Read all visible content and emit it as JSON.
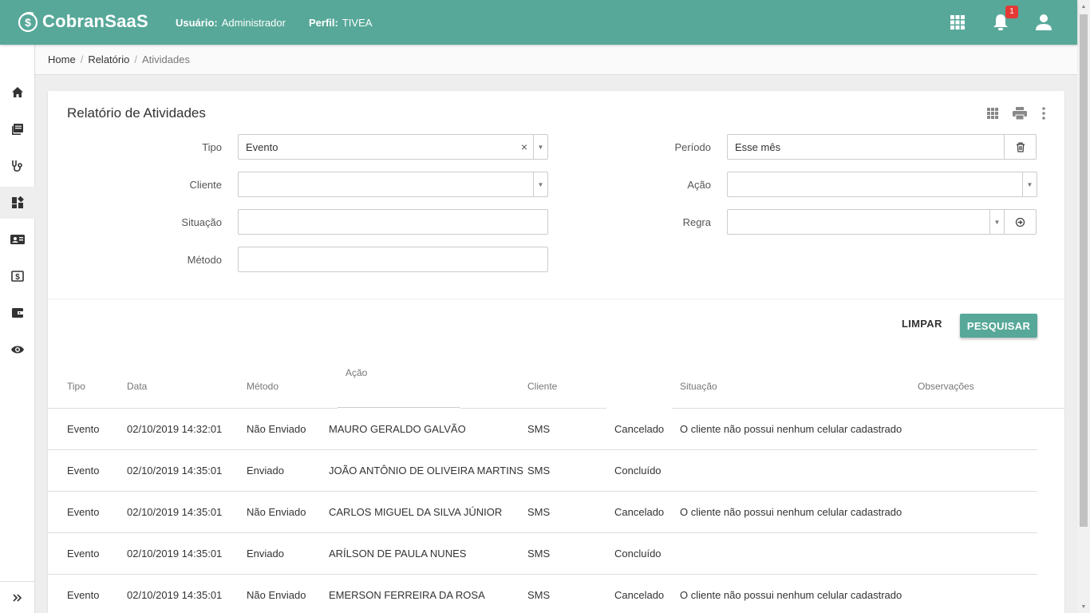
{
  "header": {
    "brand": "CobranSaaS",
    "user_label": "Usuário:",
    "user_value": "Administrador",
    "profile_label": "Perfil:",
    "profile_value": "TIVEA",
    "notifications_count": "1",
    "color": "#57a899"
  },
  "sidebar": {
    "items": [
      "home-icon",
      "book-icon",
      "stethoscope-icon",
      "dashboard-icon",
      "contact-card-icon",
      "money-icon",
      "wallet-icon",
      "eye-icon"
    ],
    "active_index": 3,
    "expand_icon": "double-chevron-right-icon"
  },
  "breadcrumb": [
    "Home",
    "Relatório",
    "Atividades"
  ],
  "card": {
    "title": "Relatório de Atividades"
  },
  "filters": {
    "tipo_label": "Tipo",
    "tipo_value": "Evento",
    "cliente_label": "Cliente",
    "cliente_value": "",
    "situacao_label": "Situação",
    "situacao_value": "",
    "metodo_label": "Método",
    "metodo_value": "",
    "periodo_label": "Período",
    "periodo_value": "Esse mês",
    "acao_label": "Ação",
    "acao_value": "",
    "regra_label": "Regra",
    "regra_value": ""
  },
  "actions": {
    "clear_label": "LIMPAR",
    "search_label": "PESQUISAR"
  },
  "table": {
    "columns": [
      "Tipo",
      "Data",
      "Método",
      "Ação",
      "Cliente",
      "Situação",
      "Observações"
    ],
    "rows": [
      [
        "Evento",
        "02/10/2019 14:32:01",
        "Não Enviado",
        "MAURO GERALDO GALVÃO",
        "SMS",
        "Cancelado",
        "O cliente não possui nenhum celular cadastrado"
      ],
      [
        "Evento",
        "02/10/2019 14:35:01",
        "Enviado",
        "JOÃO ANTÔNIO DE OLIVEIRA MARTINS",
        "SMS",
        "Concluído",
        ""
      ],
      [
        "Evento",
        "02/10/2019 14:35:01",
        "Não Enviado",
        "CARLOS MIGUEL DA SILVA JÚNIOR",
        "SMS",
        "Cancelado",
        "O cliente não possui nenhum celular cadastrado"
      ],
      [
        "Evento",
        "02/10/2019 14:35:01",
        "Enviado",
        "ARÍLSON DE PAULA NUNES",
        "SMS",
        "Concluído",
        ""
      ],
      [
        "Evento",
        "02/10/2019 14:35:01",
        "Não Enviado",
        "EMERSON FERREIRA DA ROSA",
        "SMS",
        "Cancelado",
        "O cliente não possui nenhum celular cadastrado"
      ]
    ]
  }
}
